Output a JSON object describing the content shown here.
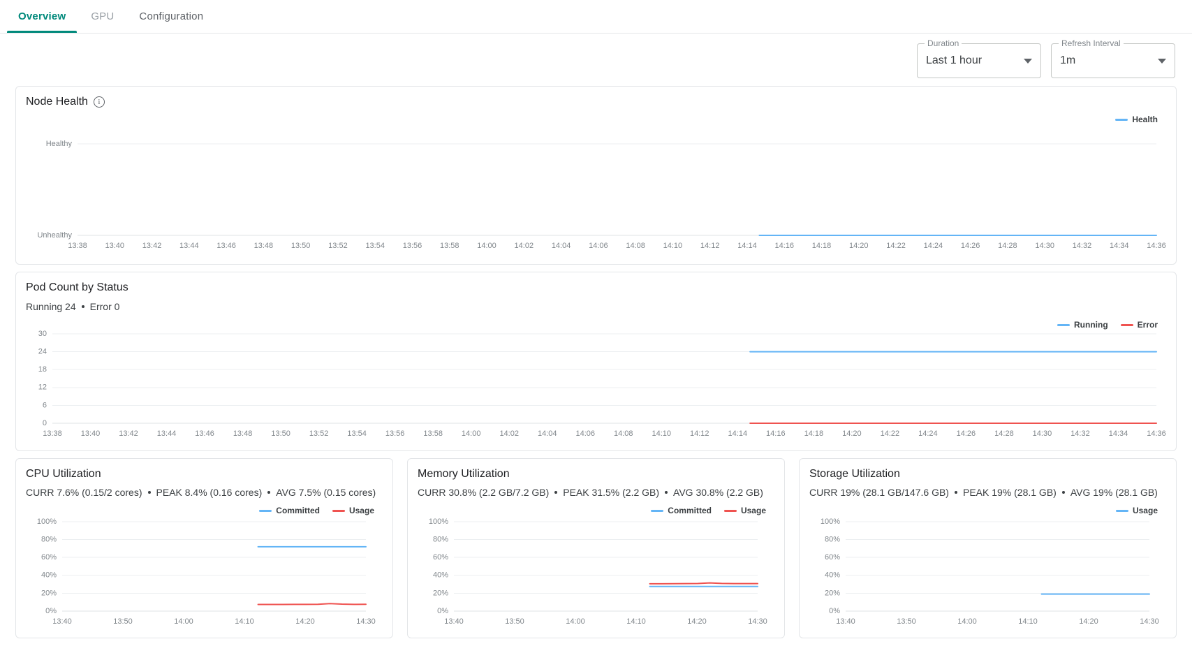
{
  "tabs": [
    {
      "label": "Overview",
      "state": "active"
    },
    {
      "label": "GPU",
      "state": "muted"
    },
    {
      "label": "Configuration",
      "state": "normal"
    }
  ],
  "controls": {
    "duration": {
      "label": "Duration",
      "value": "Last 1 hour"
    },
    "refresh": {
      "label": "Refresh Interval",
      "value": "1m"
    }
  },
  "colors": {
    "accent": "#00897b",
    "blue": "#64b5f6",
    "red": "#ef5350"
  },
  "node_health": {
    "title": "Node Health",
    "info_icon": "info-icon",
    "legend": [
      {
        "label": "Health",
        "color": "#64b5f6"
      }
    ]
  },
  "pod_count": {
    "title": "Pod Count by Status",
    "stats": [
      "Running 24",
      "Error 0"
    ],
    "legend": [
      {
        "label": "Running",
        "color": "#64b5f6"
      },
      {
        "label": "Error",
        "color": "#ef5350"
      }
    ]
  },
  "cpu": {
    "title": "CPU Utilization",
    "stats": [
      "CURR 7.6% (0.15/2 cores)",
      "PEAK 8.4% (0.16 cores)",
      "AVG 7.5% (0.15 cores)"
    ],
    "legend": [
      {
        "label": "Committed",
        "color": "#64b5f6"
      },
      {
        "label": "Usage",
        "color": "#ef5350"
      }
    ]
  },
  "memory": {
    "title": "Memory Utilization",
    "stats": [
      "CURR 30.8% (2.2 GB/7.2 GB)",
      "PEAK 31.5% (2.2 GB)",
      "AVG 30.8% (2.2 GB)"
    ],
    "legend": [
      {
        "label": "Committed",
        "color": "#64b5f6"
      },
      {
        "label": "Usage",
        "color": "#ef5350"
      }
    ]
  },
  "storage": {
    "title": "Storage Utilization",
    "stats": [
      "CURR 19% (28.1 GB/147.6 GB)",
      "PEAK 19% (28.1 GB)",
      "AVG 19% (28.1 GB)"
    ],
    "legend": [
      {
        "label": "Usage",
        "color": "#64b5f6"
      }
    ]
  },
  "chart_data": [
    {
      "id": "node-health",
      "type": "line",
      "title": "Node Health",
      "xlabel": "",
      "ylabel": "",
      "ytick_labels": [
        "Unhealthy",
        "Healthy"
      ],
      "ylim": [
        0,
        1
      ],
      "grid": true,
      "legend_position": "top-right",
      "x": [
        "13:38",
        "13:40",
        "13:42",
        "13:44",
        "13:46",
        "13:48",
        "13:50",
        "13:52",
        "13:54",
        "13:56",
        "13:58",
        "14:00",
        "14:02",
        "14:04",
        "14:06",
        "14:08",
        "14:10",
        "14:12",
        "14:14",
        "14:16",
        "14:18",
        "14:20",
        "14:22",
        "14:24",
        "14:26",
        "14:28",
        "14:30",
        "14:32",
        "14:34",
        "14:36"
      ],
      "series": [
        {
          "name": "Health",
          "color": "#64b5f6",
          "start_x": "14:15",
          "values": [
            null,
            null,
            null,
            null,
            null,
            null,
            null,
            null,
            null,
            null,
            null,
            null,
            null,
            null,
            null,
            null,
            null,
            null,
            null,
            0,
            0,
            0,
            0,
            0,
            0,
            0,
            0,
            0,
            0,
            0
          ]
        }
      ]
    },
    {
      "id": "pod-count",
      "type": "line",
      "title": "Pod Count by Status",
      "xlabel": "",
      "ylabel": "",
      "ytick_labels": [
        "0",
        "6",
        "12",
        "18",
        "24",
        "30"
      ],
      "ylim": [
        0,
        30
      ],
      "grid": true,
      "legend_position": "top-right",
      "x": [
        "13:38",
        "13:40",
        "13:42",
        "13:44",
        "13:46",
        "13:48",
        "13:50",
        "13:52",
        "13:54",
        "13:56",
        "13:58",
        "14:00",
        "14:02",
        "14:04",
        "14:06",
        "14:08",
        "14:10",
        "14:12",
        "14:14",
        "14:16",
        "14:18",
        "14:20",
        "14:22",
        "14:24",
        "14:26",
        "14:28",
        "14:30",
        "14:32",
        "14:34",
        "14:36"
      ],
      "series": [
        {
          "name": "Running",
          "color": "#64b5f6",
          "start_x": "14:15",
          "values": [
            null,
            null,
            null,
            null,
            null,
            null,
            null,
            null,
            null,
            null,
            null,
            null,
            null,
            null,
            null,
            null,
            null,
            null,
            null,
            24,
            24,
            24,
            24,
            24,
            24,
            24,
            24,
            24,
            24,
            24
          ]
        },
        {
          "name": "Error",
          "color": "#ef5350",
          "start_x": "14:15",
          "values": [
            null,
            null,
            null,
            null,
            null,
            null,
            null,
            null,
            null,
            null,
            null,
            null,
            null,
            null,
            null,
            null,
            null,
            null,
            null,
            0,
            0,
            0,
            0,
            0,
            0,
            0,
            0,
            0,
            0,
            0
          ]
        }
      ]
    },
    {
      "id": "cpu-utilization",
      "type": "line",
      "title": "CPU Utilization",
      "xlabel": "",
      "ylabel": "",
      "ytick_labels": [
        "0%",
        "20%",
        "40%",
        "60%",
        "80%",
        "100%"
      ],
      "ylim": [
        0,
        100
      ],
      "grid": true,
      "legend_position": "top-right",
      "x": [
        "13:40",
        "13:50",
        "14:00",
        "14:10",
        "14:20",
        "14:30"
      ],
      "xlim": [
        "13:35",
        "14:37"
      ],
      "series": [
        {
          "name": "Committed",
          "color": "#64b5f6",
          "start_x": "14:15",
          "values": [
            72,
            72,
            72,
            72,
            72,
            72,
            72,
            72,
            72,
            72
          ]
        },
        {
          "name": "Usage",
          "color": "#ef5350",
          "start_x": "14:15",
          "values": [
            7.4,
            7.4,
            7.4,
            7.5,
            7.5,
            7.6,
            8.4,
            7.8,
            7.5,
            7.6
          ]
        }
      ]
    },
    {
      "id": "memory-utilization",
      "type": "line",
      "title": "Memory Utilization",
      "xlabel": "",
      "ylabel": "",
      "ytick_labels": [
        "0%",
        "20%",
        "40%",
        "60%",
        "80%",
        "100%"
      ],
      "ylim": [
        0,
        100
      ],
      "grid": true,
      "legend_position": "top-right",
      "x": [
        "13:40",
        "13:50",
        "14:00",
        "14:10",
        "14:20",
        "14:30"
      ],
      "xlim": [
        "13:35",
        "14:37"
      ],
      "series": [
        {
          "name": "Committed",
          "color": "#64b5f6",
          "start_x": "14:15",
          "values": [
            27.5,
            27.5,
            27.5,
            27.5,
            27.5,
            27.5,
            27.5,
            27.5,
            27.5,
            27.5
          ]
        },
        {
          "name": "Usage",
          "color": "#ef5350",
          "start_x": "14:15",
          "values": [
            30.6,
            30.6,
            30.7,
            30.8,
            30.9,
            31.5,
            31.0,
            30.8,
            30.8,
            30.8
          ]
        }
      ]
    },
    {
      "id": "storage-utilization",
      "type": "line",
      "title": "Storage Utilization",
      "xlabel": "",
      "ylabel": "",
      "ytick_labels": [
        "0%",
        "20%",
        "40%",
        "60%",
        "80%",
        "100%"
      ],
      "ylim": [
        0,
        100
      ],
      "grid": true,
      "legend_position": "top-right",
      "x": [
        "13:40",
        "13:50",
        "14:00",
        "14:10",
        "14:20",
        "14:30"
      ],
      "xlim": [
        "13:35",
        "14:37"
      ],
      "series": [
        {
          "name": "Usage",
          "color": "#64b5f6",
          "start_x": "14:15",
          "values": [
            19,
            19,
            19,
            19,
            19,
            19,
            19,
            19,
            19,
            19
          ]
        }
      ]
    }
  ]
}
